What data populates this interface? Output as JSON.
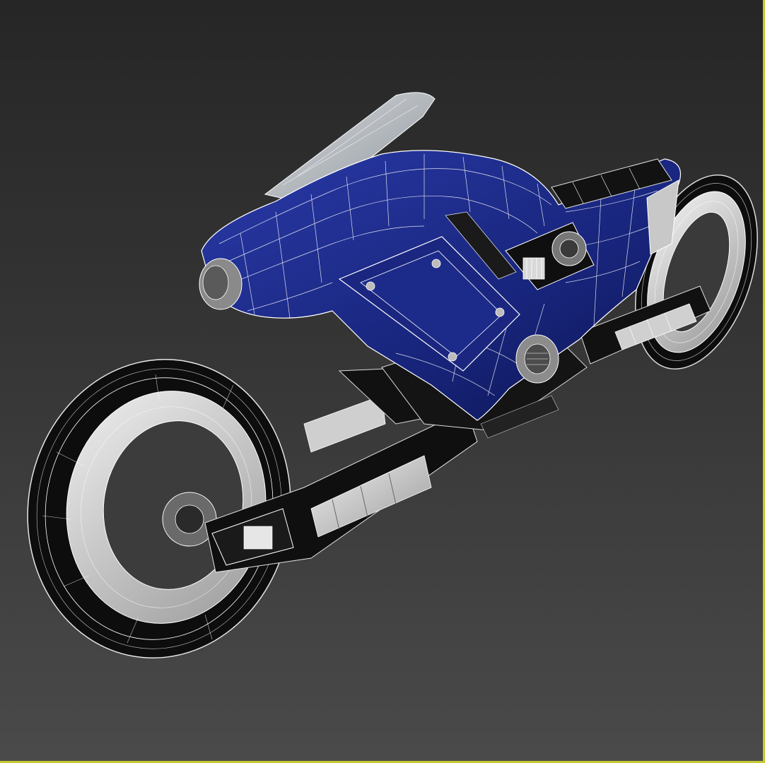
{
  "viewport": {
    "active_border_color": "#c8c832",
    "background_top": "#262626",
    "background_bottom": "#4a4a4a",
    "display_mode": "shaded-with-wireframe"
  },
  "model": {
    "body_color": "#1b2a8c",
    "wire_color": "#ffffff",
    "tire_color": "#0d0d0d",
    "rim_color": "#d8d8d8",
    "glass_color": "#cfd4da"
  }
}
